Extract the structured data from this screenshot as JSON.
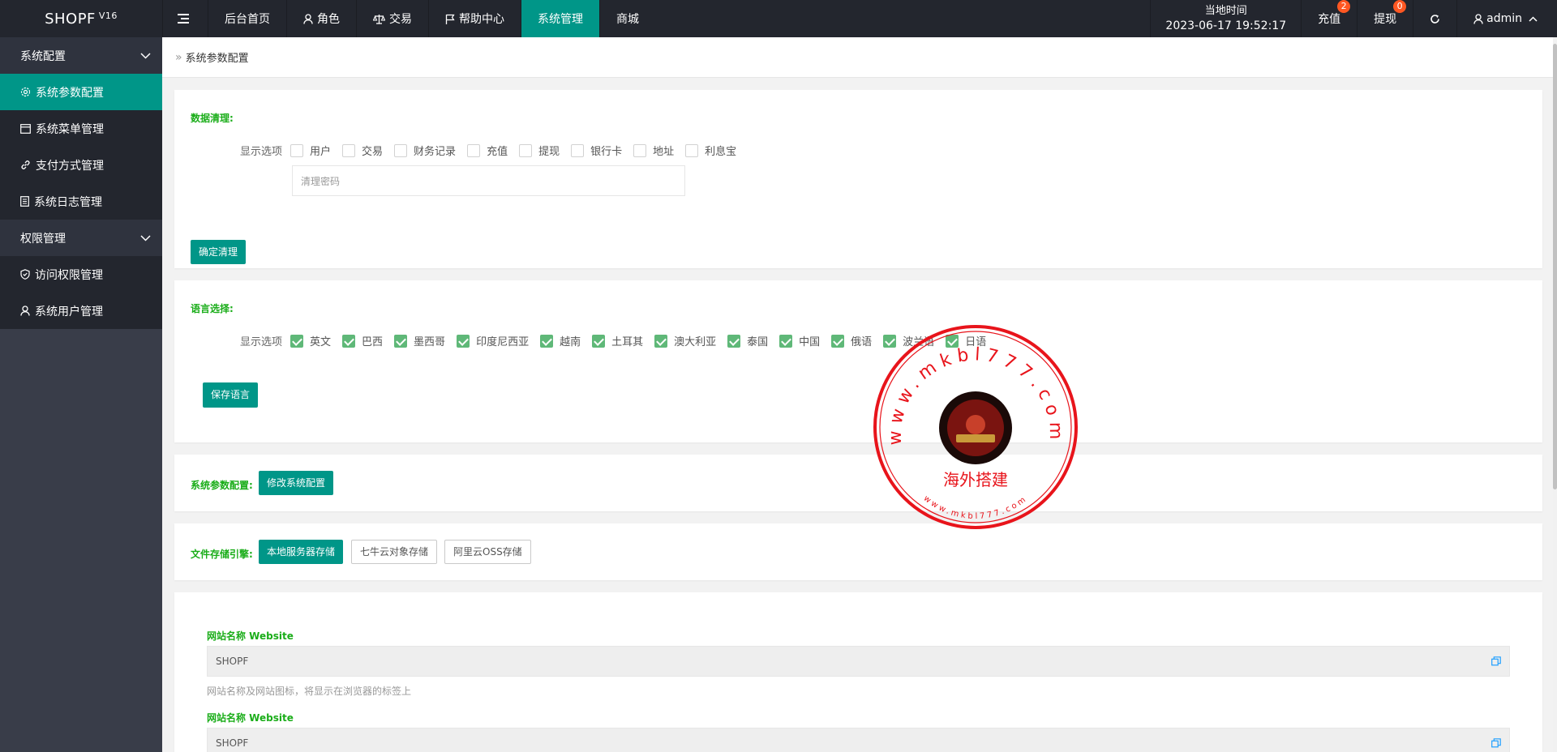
{
  "app": {
    "name": "SHOPF",
    "version": "V16"
  },
  "topnav": [
    {
      "label": "后台首页",
      "icon": ""
    },
    {
      "label": "角色",
      "icon": "user-icon"
    },
    {
      "label": "交易",
      "icon": "scale-icon"
    },
    {
      "label": "帮助中心",
      "icon": "flag-icon"
    },
    {
      "label": "系统管理",
      "icon": "",
      "active": true
    },
    {
      "label": "商城",
      "icon": ""
    }
  ],
  "header_right": {
    "clock_label": "当地时间",
    "clock_value": "2023-06-17 19:52:17",
    "recharge_label": "充值",
    "recharge_badge": "2",
    "withdraw_label": "提现",
    "withdraw_badge": "0",
    "user": "admin"
  },
  "sidebar": {
    "group1": "系统配置",
    "items1": [
      "系统参数配置",
      "系统菜单管理",
      "支付方式管理",
      "系统日志管理"
    ],
    "group2": "权限管理",
    "items2": [
      "访问权限管理",
      "系统用户管理"
    ]
  },
  "breadcrumb": "系统参数配置",
  "data_clear": {
    "title": "数据清理:",
    "label": "显示选项",
    "options": [
      "用户",
      "交易",
      "财务记录",
      "充值",
      "提现",
      "银行卡",
      "地址",
      "利息宝"
    ],
    "password_placeholder": "清理密码",
    "button": "确定清理"
  },
  "language": {
    "title": "语言选择:",
    "label": "显示选项",
    "options": [
      "英文",
      "巴西",
      "墨西哥",
      "印度尼西亚",
      "越南",
      "土耳其",
      "澳大利亚",
      "泰国",
      "中国",
      "俄语",
      "波兰语",
      "日语"
    ],
    "button": "保存语言"
  },
  "sys_params": {
    "title": "系统参数配置:",
    "button": "修改系统配置"
  },
  "storage": {
    "title": "文件存储引擎:",
    "options": [
      "本地服务器存储",
      "七牛云对象存储",
      "阿里云OSS存储"
    ]
  },
  "site": {
    "field1_label": "网站名称 Website",
    "field1_value": "SHOPF",
    "field1_help": "网站名称及网站图标，将显示在浏览器的标签上",
    "field2_label": "网站名称 Website",
    "field2_value": "SHOPF"
  },
  "stamp": {
    "url_text": "www.mkbl777.com",
    "name": "海外搭建",
    "color": "#e8141b"
  },
  "colors": {
    "primary": "#009688",
    "header": "#23262e",
    "sidebar": "#393d49",
    "title_green": "#1aad19",
    "badge": "#ff5722"
  }
}
